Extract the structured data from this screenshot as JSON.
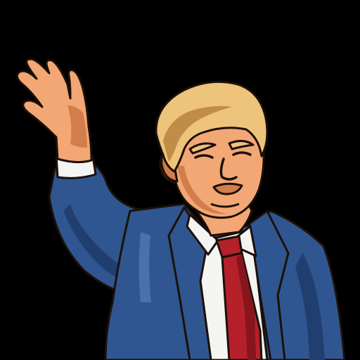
{
  "palette": {
    "background": "#000000",
    "suit": "#2f5691",
    "suit_shadow": "#203f70",
    "suit_highlight": "#4a71ad",
    "shirt": "#f4f4f2",
    "tie": "#b5202b",
    "tie_shadow": "#86151d",
    "skin": "#f3a774",
    "skin_shadow": "#d17e4c",
    "hair": "#eec37b",
    "hair_shadow": "#c08d47",
    "outline": "#1b1008"
  }
}
